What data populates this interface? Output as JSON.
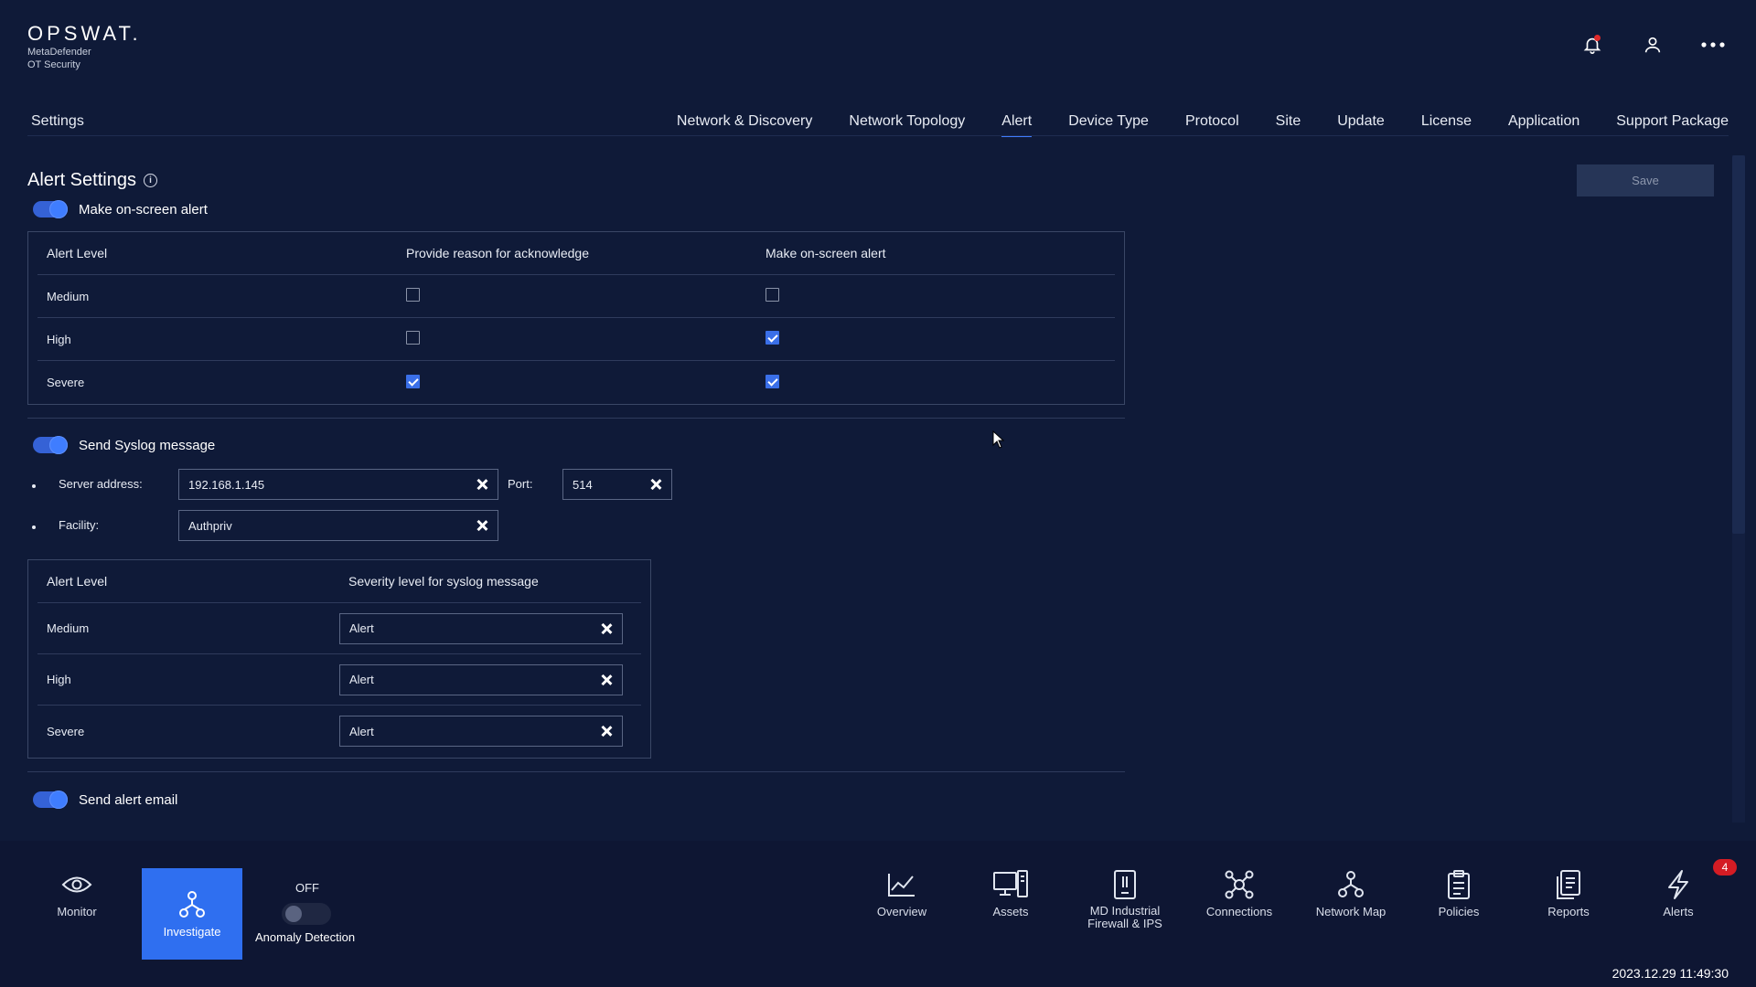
{
  "header": {
    "logo": "OPSWAT.",
    "product_line1": "MetaDefender",
    "product_line2": "OT Security",
    "icons": [
      "bell-icon",
      "user-icon",
      "more-icon"
    ]
  },
  "settings": {
    "title": "Settings",
    "tabs": [
      {
        "label": "Network & Discovery"
      },
      {
        "label": "Network Topology"
      },
      {
        "label": "Alert",
        "active": true
      },
      {
        "label": "Device Type"
      },
      {
        "label": "Protocol"
      },
      {
        "label": "Site"
      },
      {
        "label": "Update"
      },
      {
        "label": "License"
      },
      {
        "label": "Application"
      },
      {
        "label": "Support Package"
      }
    ]
  },
  "alert_settings": {
    "title": "Alert Settings",
    "save_label": "Save",
    "onscreen": {
      "toggle_label": "Make on-screen alert",
      "enabled": true,
      "columns": [
        "Alert Level",
        "Provide reason for acknowledge",
        "Make on-screen alert"
      ],
      "rows": [
        {
          "level": "Medium",
          "reason": false,
          "onscreen": false
        },
        {
          "level": "High",
          "reason": false,
          "onscreen": true
        },
        {
          "level": "Severe",
          "reason": true,
          "onscreen": true
        }
      ]
    },
    "syslog": {
      "toggle_label": "Send Syslog message",
      "enabled": true,
      "server_label": "Server address:",
      "server_value": "192.168.1.145",
      "port_label": "Port:",
      "port_value": "514",
      "facility_label": "Facility:",
      "facility_value": "Authpriv",
      "columns": [
        "Alert Level",
        "Severity level for syslog message"
      ],
      "rows": [
        {
          "level": "Medium",
          "severity": "Alert"
        },
        {
          "level": "High",
          "severity": "Alert"
        },
        {
          "level": "Severe",
          "severity": "Alert"
        }
      ]
    },
    "email": {
      "toggle_label": "Send alert email",
      "enabled": true
    }
  },
  "bottom_nav": {
    "left": [
      {
        "label": "Monitor",
        "icon": "eye-icon"
      },
      {
        "label": "Investigate",
        "icon": "hierarchy-icon",
        "active": true
      }
    ],
    "anomaly": {
      "state": "OFF",
      "label": "Anomaly Detection"
    },
    "right": [
      {
        "label": "Overview",
        "icon": "chart-line-icon"
      },
      {
        "label": "Assets",
        "icon": "devices-icon"
      },
      {
        "label": "MD Industrial\nFirewall & IPS",
        "icon": "firewall-icon"
      },
      {
        "label": "Connections",
        "icon": "connections-icon"
      },
      {
        "label": "Network Map",
        "icon": "network-map-icon"
      },
      {
        "label": "Policies",
        "icon": "clipboard-icon"
      },
      {
        "label": "Reports",
        "icon": "reports-icon"
      },
      {
        "label": "Alerts",
        "icon": "lightning-icon",
        "badge": "4"
      }
    ],
    "timestamp": "2023.12.29 11:49:30"
  },
  "colors": {
    "background": "#0f1a38",
    "accent": "#3f7dff",
    "active_nav": "#2f6ff0",
    "badge": "#d41c24"
  }
}
